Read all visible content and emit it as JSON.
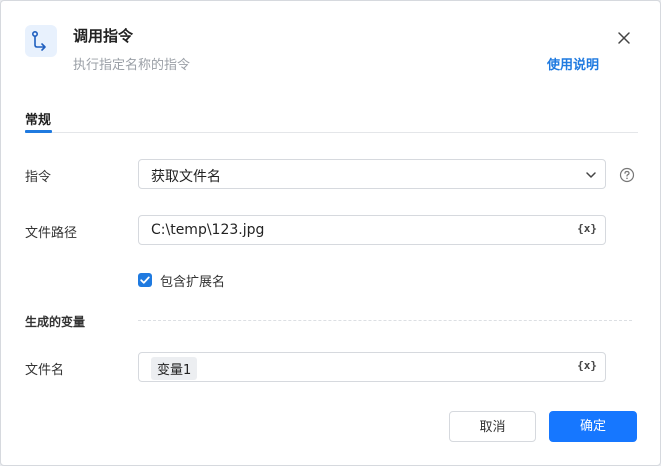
{
  "header": {
    "icon": "branch-command-icon",
    "title": "调用指令",
    "subtitle": "执行指定名称的指令",
    "help_link": "使用说明",
    "close_icon": "close-icon"
  },
  "tabs": [
    {
      "label": "常规",
      "active": true
    }
  ],
  "form": {
    "command": {
      "label": "指令",
      "value": "获取文件名",
      "icon": "chevron-down-icon",
      "help_icon": "question-circle-icon"
    },
    "file_path": {
      "label": "文件路径",
      "value": "C:\\temp\\123.jpg",
      "var_button": "{x}"
    },
    "include_extension": {
      "label": "包含扩展名",
      "checked": true
    }
  },
  "output": {
    "section_title": "生成的变量",
    "file_name": {
      "label": "文件名",
      "value": "变量1",
      "var_button": "{x}"
    }
  },
  "footer": {
    "cancel_label": "取消",
    "ok_label": "确定"
  },
  "colors": {
    "accent": "#1677ff",
    "link": "#1f7ae0"
  }
}
